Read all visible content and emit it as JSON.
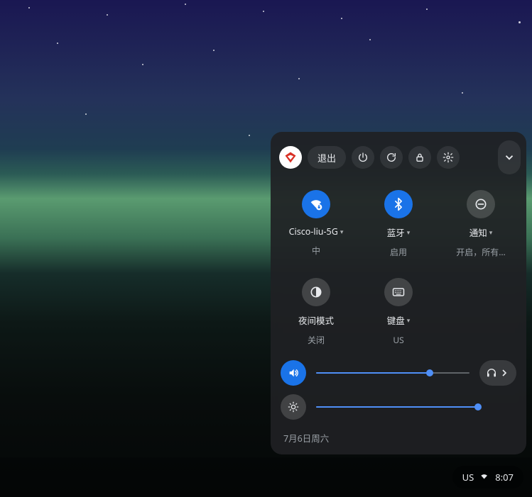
{
  "header": {
    "signout_label": "退出"
  },
  "tiles": {
    "wifi": {
      "title": "Cisco-liu-5G",
      "sub": "中"
    },
    "bluetooth": {
      "title": "蓝牙",
      "sub": "启用"
    },
    "notifications": {
      "title": "通知",
      "sub": "开启，所有…"
    },
    "nightlight": {
      "title": "夜间模式",
      "sub": "关闭"
    },
    "keyboard": {
      "title": "键盘",
      "sub": "US"
    }
  },
  "sliders": {
    "volume_percent": 74,
    "brightness_percent": 99
  },
  "footer": {
    "date": "7月6日周六"
  },
  "status": {
    "ime": "US",
    "time": "8:07"
  },
  "colors": {
    "accent": "#1a73e8"
  }
}
